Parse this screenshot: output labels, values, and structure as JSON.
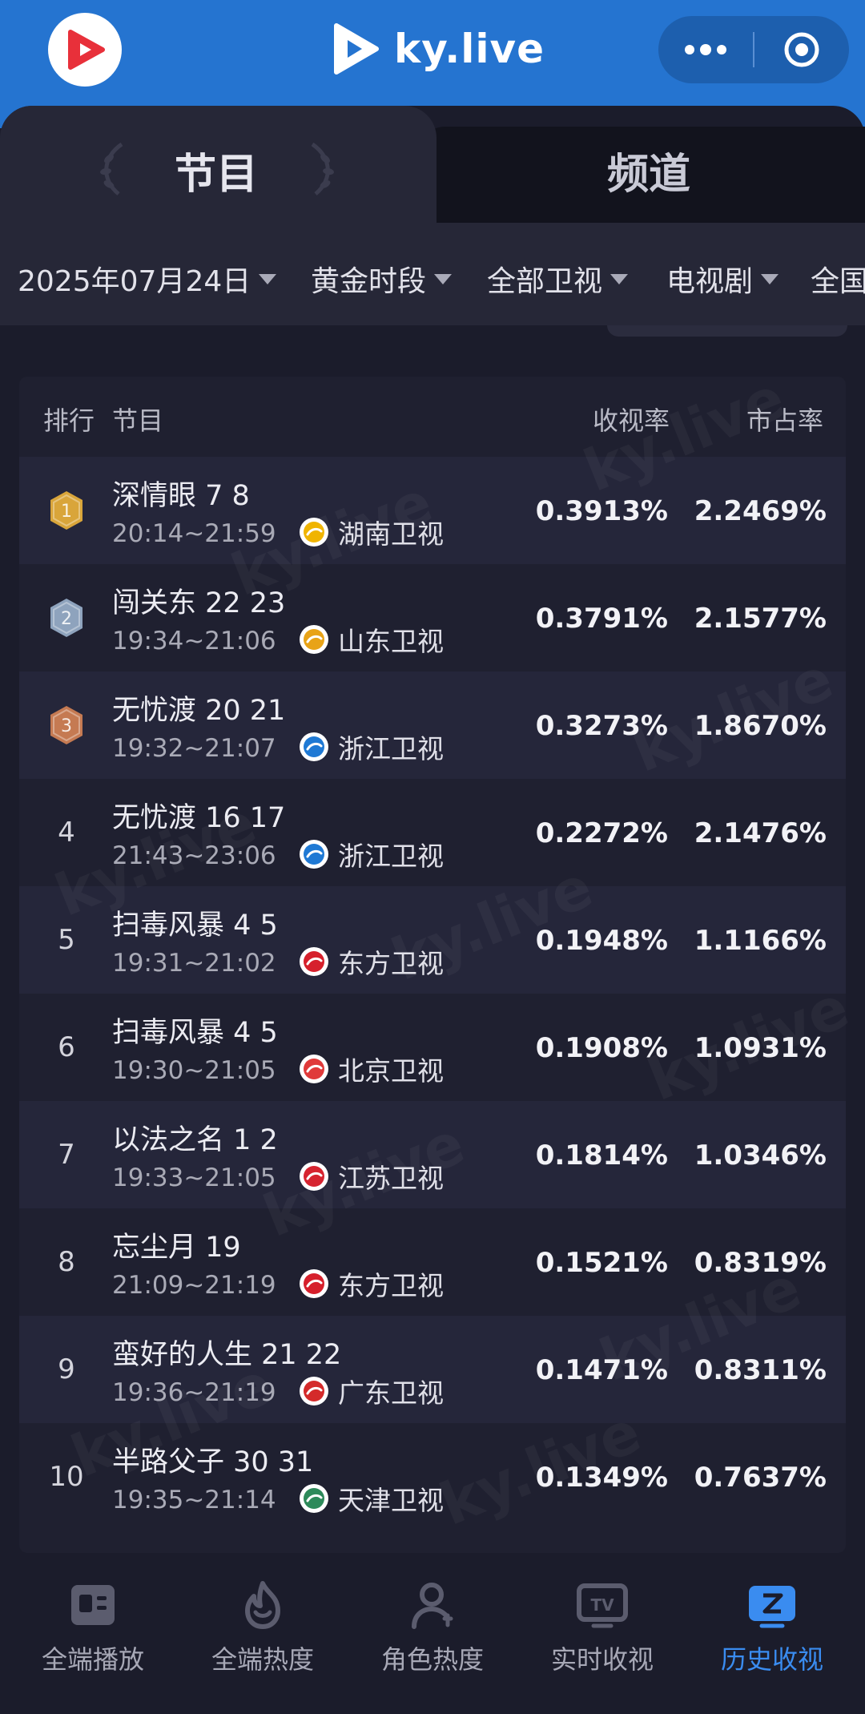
{
  "header": {
    "brand": "ky.live"
  },
  "tabs": [
    {
      "label": "节目",
      "active": true
    },
    {
      "label": "频道",
      "active": false
    }
  ],
  "filters": [
    {
      "label": "2025年07月24日"
    },
    {
      "label": "黄金时段"
    },
    {
      "label": "全部卫视"
    },
    {
      "label": "电视剧"
    },
    {
      "label": "全国"
    }
  ],
  "table": {
    "headers": {
      "rank": "排行",
      "program": "节目",
      "rating": "收视率",
      "share": "市占率"
    },
    "rows": [
      {
        "rank": "1",
        "medal": "gold",
        "title": "深情眼 7 8",
        "time": "20:14~21:59",
        "channel": "湖南卫视",
        "channel_color": "#f0b400",
        "rating": "0.3913%",
        "share": "2.2469%"
      },
      {
        "rank": "2",
        "medal": "silver",
        "title": "闯关东 22 23",
        "time": "19:34~21:06",
        "channel": "山东卫视",
        "channel_color": "#e8a317",
        "rating": "0.3791%",
        "share": "2.1577%"
      },
      {
        "rank": "3",
        "medal": "bronze",
        "title": "无忧渡 20 21",
        "time": "19:32~21:07",
        "channel": "浙江卫视",
        "channel_color": "#1f79d4",
        "rating": "0.3273%",
        "share": "1.8670%"
      },
      {
        "rank": "4",
        "medal": "",
        "title": "无忧渡 16 17",
        "time": "21:43~23:06",
        "channel": "浙江卫视",
        "channel_color": "#1f79d4",
        "rating": "0.2272%",
        "share": "2.1476%"
      },
      {
        "rank": "5",
        "medal": "",
        "title": "扫毒风暴 4 5",
        "time": "19:31~21:02",
        "channel": "东方卫视",
        "channel_color": "#d6202c",
        "rating": "0.1948%",
        "share": "1.1166%"
      },
      {
        "rank": "6",
        "medal": "",
        "title": "扫毒风暴 4 5",
        "time": "19:30~21:05",
        "channel": "北京卫视",
        "channel_color": "#e03a3a",
        "rating": "0.1908%",
        "share": "1.0931%"
      },
      {
        "rank": "7",
        "medal": "",
        "title": "以法之名 1 2",
        "time": "19:33~21:05",
        "channel": "江苏卫视",
        "channel_color": "#d62430",
        "rating": "0.1814%",
        "share": "1.0346%"
      },
      {
        "rank": "8",
        "medal": "",
        "title": "忘尘月 19",
        "time": "21:09~21:19",
        "channel": "东方卫视",
        "channel_color": "#d6202c",
        "rating": "0.1521%",
        "share": "0.8319%"
      },
      {
        "rank": "9",
        "medal": "",
        "title": "蛮好的人生 21 22",
        "time": "19:36~21:19",
        "channel": "广东卫视",
        "channel_color": "#d42a2a",
        "rating": "0.1471%",
        "share": "0.8311%"
      },
      {
        "rank": "10",
        "medal": "",
        "title": "半路父子 30 31",
        "time": "19:35~21:14",
        "channel": "天津卫视",
        "channel_color": "#2d8a5a",
        "rating": "0.1349%",
        "share": "0.7637%"
      }
    ]
  },
  "bottom_nav": [
    {
      "label": "全端播放",
      "icon": "playlist-icon",
      "active": false
    },
    {
      "label": "全端热度",
      "icon": "flame-icon",
      "active": false
    },
    {
      "label": "角色热度",
      "icon": "person-icon",
      "active": false
    },
    {
      "label": "实时收视",
      "icon": "tv-icon",
      "active": false
    },
    {
      "label": "历史收视",
      "icon": "history-icon",
      "active": true
    }
  ],
  "colors": {
    "header_blue": "#2574d0",
    "background": "#1b1c2b",
    "active_nav": "#3a8cf0",
    "gold": "#d9a53a",
    "silver": "#8ea3bd",
    "bronze": "#c57a52"
  }
}
